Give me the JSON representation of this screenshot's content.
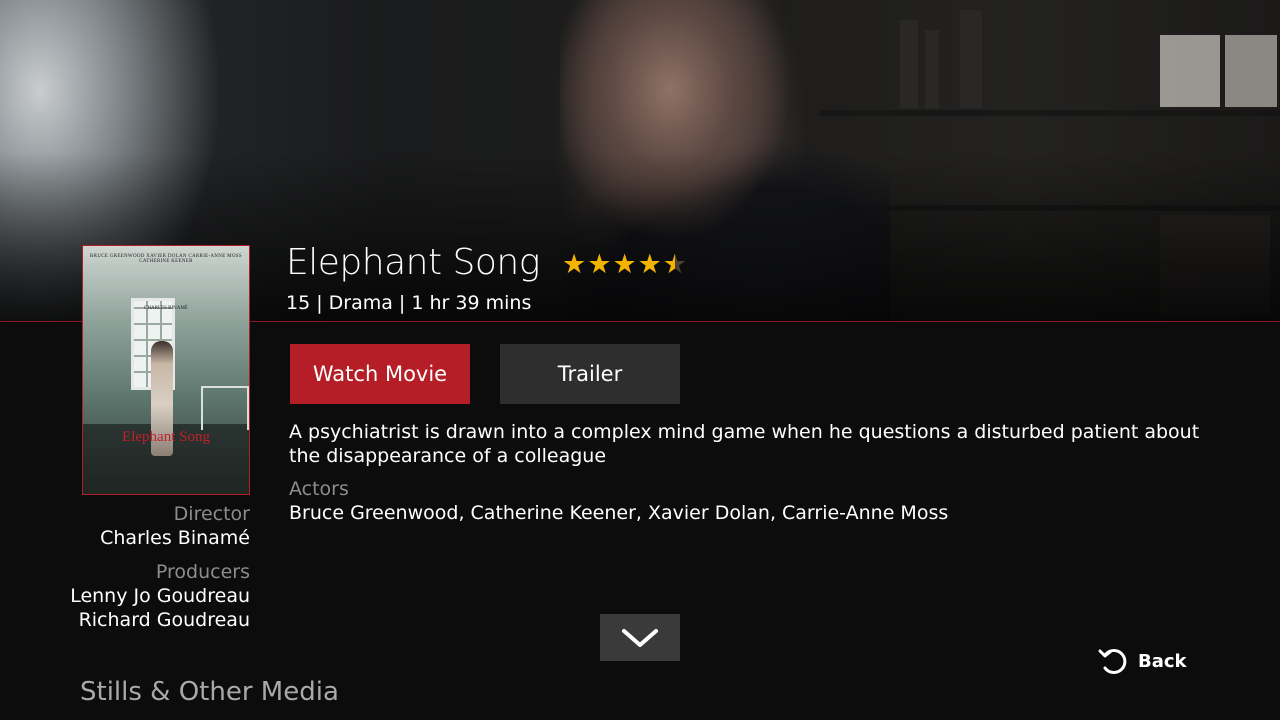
{
  "movie": {
    "title": "Elephant Song",
    "rating": 4.5,
    "meta": "15 | Drama | 1 hr 39 mins",
    "synopsis": "A psychiatrist is drawn into a complex mind game when he questions a disturbed patient about the disappearance of a colleague",
    "actors_heading": "Actors",
    "actors": "Bruce Greenwood, Catherine Keener, Xavier Dolan, Carrie-Anne Moss",
    "director_heading": "Director",
    "director": "Charles Binamé",
    "producers_heading": "Producers",
    "producers": [
      "Lenny Jo Goudreau",
      "Richard Goudreau"
    ]
  },
  "poster": {
    "credits": "BRUCE GREENWOOD   XAVIER DOLAN   CARRIE-ANNE MOSS   CATHERINE KEENER",
    "director_credit": "CHARLES BINAMÉ",
    "title": "Elephant Song"
  },
  "buttons": {
    "watch": "Watch Movie",
    "trailer": "Trailer"
  },
  "nav": {
    "back": "Back",
    "section": "Stills & Other Media"
  },
  "colors": {
    "accent": "#b51e27",
    "star": "#f5b301"
  },
  "icons": {
    "more": "chevron-down-icon",
    "back": "back-arrow-icon"
  }
}
